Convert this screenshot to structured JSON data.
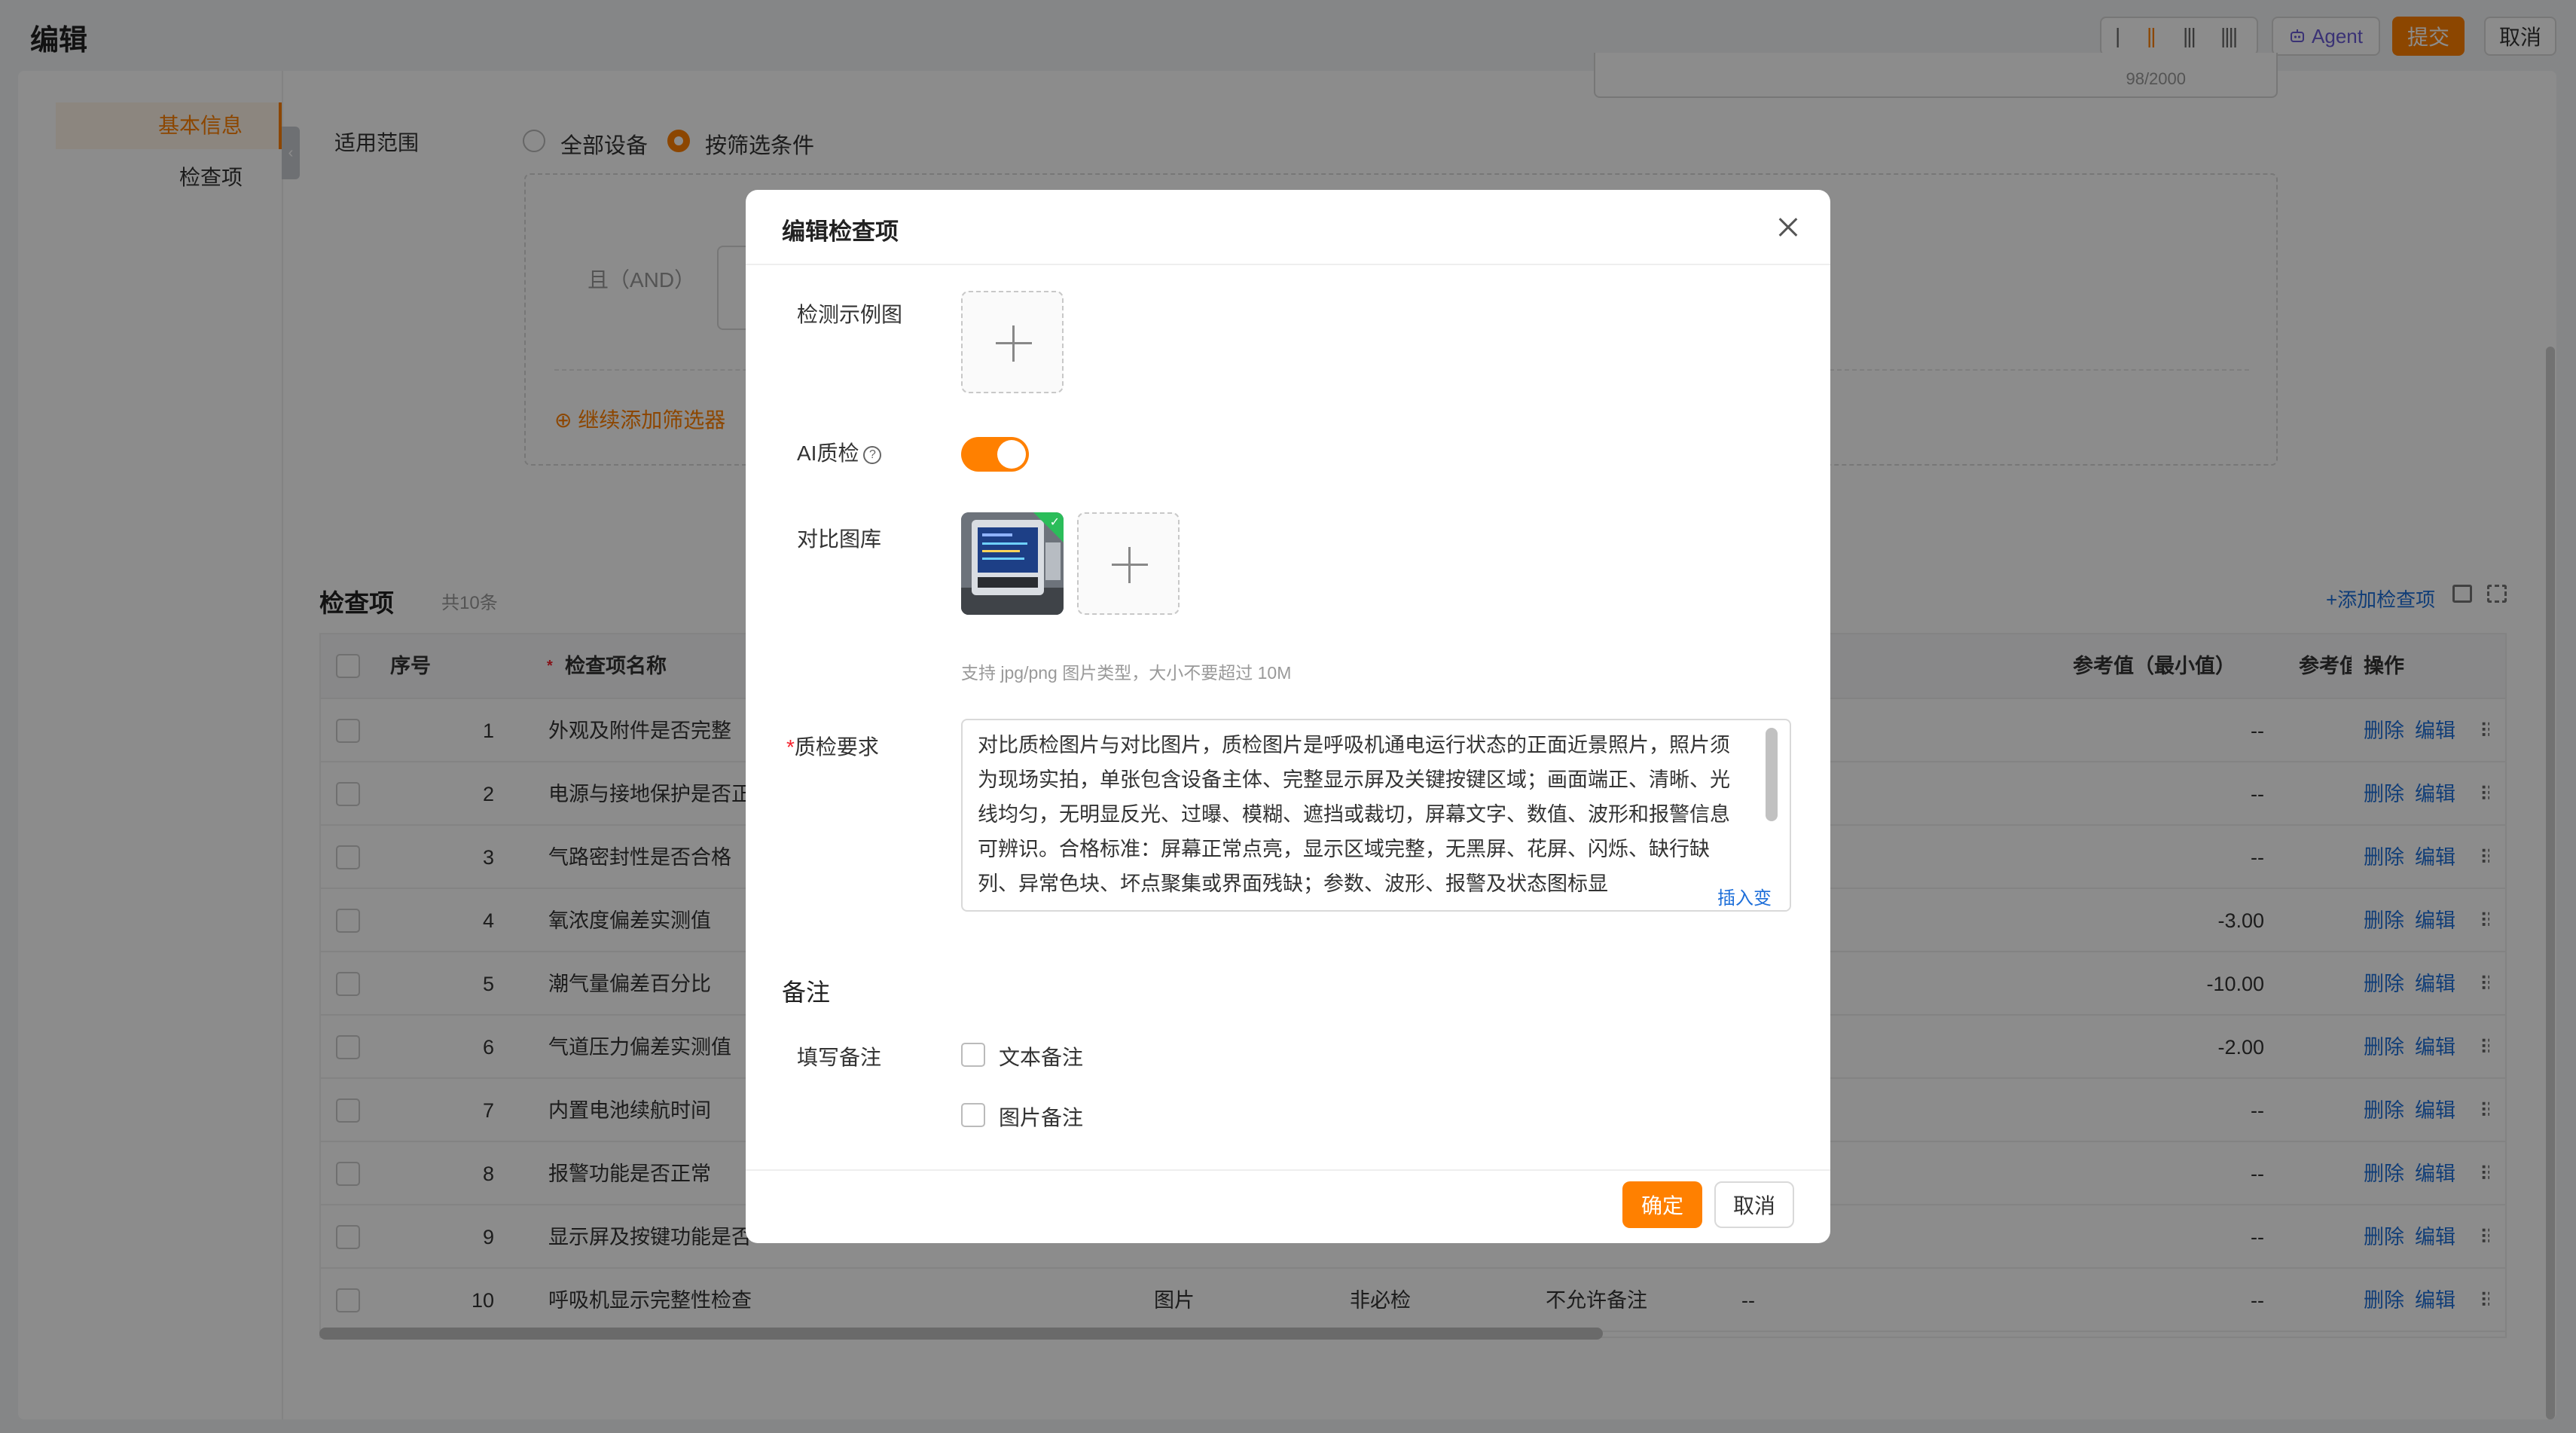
{
  "page": {
    "title": "编辑",
    "header": {
      "agent_label": "Agent",
      "submit_label": "提交",
      "cancel_label": "取消"
    },
    "char_count": "98/2000"
  },
  "sidebar": {
    "items": [
      {
        "label": "基本信息",
        "active": true
      },
      {
        "label": "检查项",
        "active": false
      }
    ]
  },
  "scope": {
    "label": "适用范围",
    "options": [
      {
        "label": "全部设备",
        "selected": false
      },
      {
        "label": "按筛选条件",
        "selected": true
      }
    ],
    "and_label": "且（AND）",
    "add_filter": "⊕ 继续添加筛选器"
  },
  "check_items": {
    "title": "检查项",
    "count": "共10条",
    "add_link": "+添加检查项",
    "columns": {
      "index": "序号",
      "name": "检查项名称",
      "ref_min": "参考值（最小值）",
      "ref_max": "参考值",
      "ops": "操作"
    },
    "action_delete": "删除",
    "action_edit": "编辑",
    "rows": [
      {
        "index": "1",
        "name": "外观及附件是否完整",
        "ref_min": "--"
      },
      {
        "index": "2",
        "name": "电源与接地保护是否正",
        "ref_min": "--"
      },
      {
        "index": "3",
        "name": "气路密封性是否合格",
        "ref_min": "--"
      },
      {
        "index": "4",
        "name": "氧浓度偏差实测值",
        "ref_min": "-3.00"
      },
      {
        "index": "5",
        "name": "潮气量偏差百分比",
        "ref_min": "-10.00"
      },
      {
        "index": "6",
        "name": "气道压力偏差实测值",
        "ref_min": "-2.00"
      },
      {
        "index": "7",
        "name": "内置电池续航时间",
        "ref_min": "--"
      },
      {
        "index": "8",
        "name": "报警功能是否正常",
        "ref_min": "--"
      },
      {
        "index": "9",
        "name": "显示屏及按键功能是否",
        "ref_min": "--"
      },
      {
        "index": "10",
        "name": "呼吸机显示完整性检查",
        "type": "图片",
        "required": "非必检",
        "remark": "不允许备注",
        "extra": "--",
        "ref_min": "--"
      }
    ]
  },
  "modal": {
    "title": "编辑检查项",
    "sample_image_label": "检测示例图",
    "ai_qc_label": "AI质检",
    "ai_qc_enabled": true,
    "gallery_label": "对比图库",
    "upload_hint": "支持 jpg/png 图片类型，大小不要超过 10M",
    "requirement_label": "质检要求",
    "requirement_text": "对比质检图片与对比图片，质检图片是呼吸机通电运行状态的正面近景照片，照片须为现场实拍，单张包含设备主体、完整显示屏及关键按键区域；画面端正、清晰、光线均匀，无明显反光、过曝、模糊、遮挡或裁切，屏幕文字、数值、波形和报警信息可辨识。合格标准：屏幕正常点亮，显示区域完整，无黑屏、花屏、闪烁、缺行缺列、异常色块、坏点聚集或界面残缺；参数、波形、报警及状态图标显",
    "insert_variable": "插入变量",
    "remark_section": "备注",
    "remark_label": "填写备注",
    "remark_options": [
      {
        "label": "文本备注",
        "checked": false
      },
      {
        "label": "图片备注",
        "checked": false
      }
    ],
    "ok_label": "确定",
    "cancel_label": "取消"
  },
  "colors": {
    "accent": "#ff8000",
    "link": "#1e6fd9",
    "success": "#2bbd5a"
  }
}
